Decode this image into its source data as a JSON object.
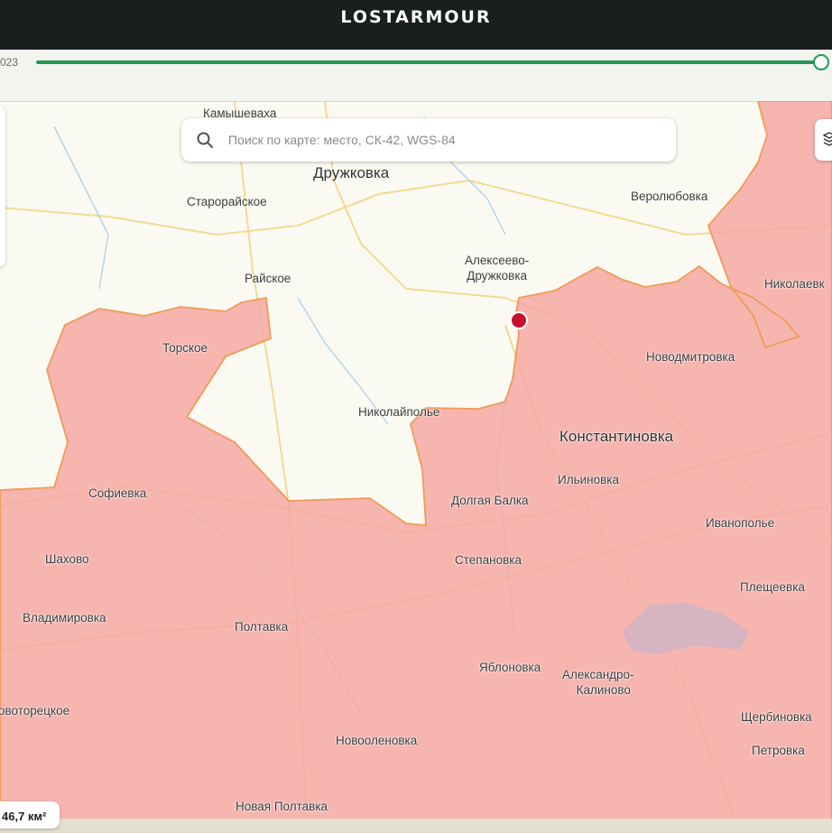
{
  "header": {
    "brand": "LOSTARMOUR"
  },
  "timeline": {
    "date_fragment": "023",
    "progress": 1.0
  },
  "search": {
    "placeholder": "Поиск по карте: место, СК-42, WGS-84"
  },
  "map": {
    "controlled_area_color": "#f6a8a4",
    "frontline_color": "#f09a55",
    "marker_color": "#c8102e",
    "places": {
      "druzhkovka": "Дружковка",
      "kamyshevakha": "Камышеваха",
      "staroraiskoe": "Старорайское",
      "verolyubovka": "Веролюбовка",
      "alekseevo_line1": "Алексеево-",
      "alekseevo_line2": "Дружковка",
      "raiskoe": "Райское",
      "nikolaevka": "Николаевк",
      "torskoe": "Торское",
      "novodmitrovka": "Новодмитровка",
      "nikolaypolye": "Николайполье",
      "konstantinovka": "Константиновка",
      "sofievka": "Софиевка",
      "ilinovka": "Ильиновка",
      "dolgaya_balka": "Долгая Балка",
      "ivanopolye": "Иванополье",
      "shakhovo": "Шахово",
      "stepanovka": "Степановка",
      "pleshcheevka": "Плещеевка",
      "vladimirovka": "Владимировка",
      "poltavka": "Полтавка",
      "yablonovka": "Яблоновка",
      "aleksandro_line1": "Александро-",
      "aleksandro_line2": "Калиново",
      "novotoretskoe": "овоторецкое",
      "shcherbinovka": "Щербиновка",
      "novoolenovka": "Новооленовка",
      "petrovka": "Петровка",
      "novaya_poltavka": "Новая Полтавка"
    },
    "area_badge": "46,7 км²"
  }
}
